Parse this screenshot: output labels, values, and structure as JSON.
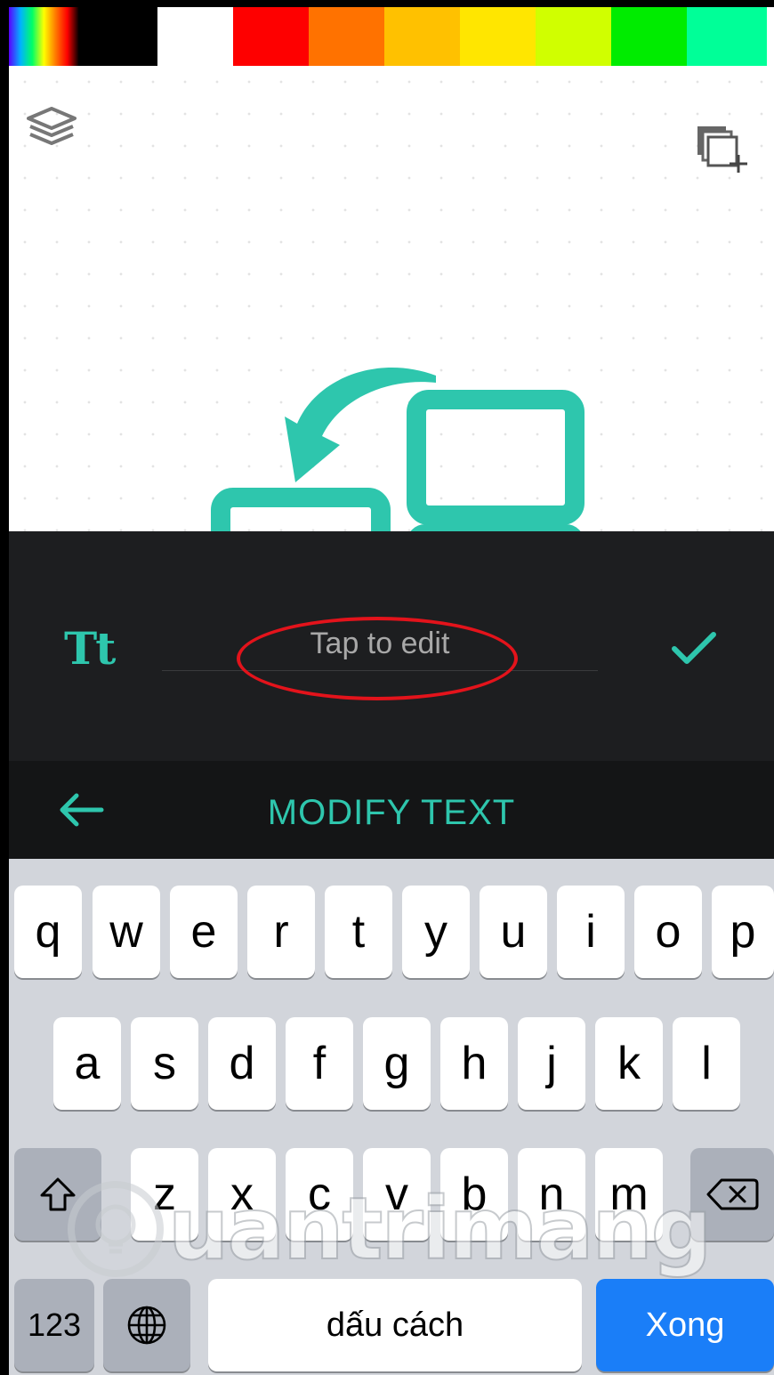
{
  "palette": {
    "colors": [
      "#000000",
      "#ffffff",
      "#fe0000",
      "#ff7200",
      "#ffc100",
      "#ffe600",
      "#d0ff00",
      "#00ec00",
      "#00ff98"
    ]
  },
  "canvas": {
    "layers_icon": "layers-icon",
    "duplicate_icon": "duplicate-layer-icon",
    "accent_color": "#2ec6ad"
  },
  "editor": {
    "font_icon_label": "Tt",
    "text_placeholder": "Tap to edit",
    "confirm_icon": "checkmark-icon"
  },
  "modify_bar": {
    "back_icon": "arrow-left-icon",
    "title": "MODIFY TEXT"
  },
  "keyboard": {
    "row1": [
      "q",
      "w",
      "e",
      "r",
      "t",
      "y",
      "u",
      "i",
      "o",
      "p"
    ],
    "row2": [
      "a",
      "s",
      "d",
      "f",
      "g",
      "h",
      "j",
      "k",
      "l"
    ],
    "row3": [
      "z",
      "x",
      "c",
      "v",
      "b",
      "n",
      "m"
    ],
    "numbers_label": "123",
    "globe_icon": "globe-icon",
    "space_label": "dấu cách",
    "done_label": "Xong",
    "shift_icon": "shift-icon",
    "backspace_icon": "backspace-icon"
  },
  "watermark": {
    "text": "uantrimang"
  }
}
